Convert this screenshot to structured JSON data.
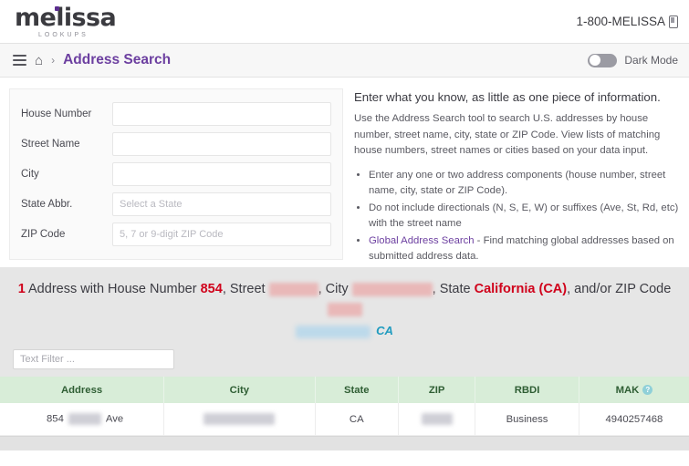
{
  "header": {
    "logo_text": "melissa",
    "logo_sub": "LOOKUPS",
    "phone": "1-800-MELISSA"
  },
  "nav": {
    "home_glyph": "⌂",
    "separator": "›",
    "breadcrumb_current": "Address Search",
    "dark_mode_label": "Dark Mode",
    "dark_mode_on": false
  },
  "form": {
    "fields": [
      {
        "label": "House Number",
        "value": "",
        "placeholder": ""
      },
      {
        "label": "Street Name",
        "value": "",
        "placeholder": ""
      },
      {
        "label": "City",
        "value": "",
        "placeholder": ""
      },
      {
        "label": "State Abbr.",
        "value": "",
        "placeholder": "Select a State"
      },
      {
        "label": "ZIP Code",
        "value": "",
        "placeholder": "5, 7 or 9-digit ZIP Code"
      }
    ]
  },
  "info": {
    "heading": "Enter what you know, as little as one piece of information.",
    "paragraph": "Use the Address Search tool to search U.S. addresses by house number, street name, city, state or ZIP Code. View lists of matching house numbers, street names or cities based on your data input.",
    "bullets": [
      "Enter any one or two address components (house number, street name, city, state or ZIP Code).",
      "Do not include directionals (N, S, E, W) or suffixes (Ave, St, Rd, etc) with the street name"
    ],
    "link_label": "Global Address Search",
    "link_tail": " - Find matching global addresses based on submitted address data."
  },
  "summary": {
    "count": "1",
    "text_1": "Address with House Number",
    "house_number": "854",
    "text_2": ", Street",
    "text_3": ", City",
    "text_4": ", State",
    "state": "California (CA)",
    "text_5": ", and/or ZIP Code",
    "state_italic": "CA"
  },
  "filter": {
    "placeholder": "Text Filter ...",
    "value": ""
  },
  "table": {
    "columns": [
      "Address",
      "City",
      "State",
      "ZIP",
      "RBDI",
      "MAK"
    ],
    "mak_info_glyph": "?",
    "rows": [
      {
        "address_number": "854",
        "address_suffix": "Ave",
        "city": "",
        "state": "CA",
        "zip": "",
        "rbdi": "Business",
        "mak": "4940257468"
      }
    ]
  },
  "colors": {
    "brand_purple": "#6c3fa0",
    "alert_red": "#d0021b",
    "table_header_green": "#d8edd8",
    "link_teal": "#1f9bbf"
  }
}
